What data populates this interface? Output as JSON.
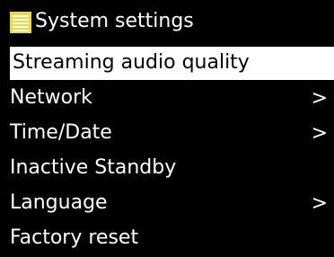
{
  "header": {
    "title": "System settings",
    "icon": "menu-list-icon",
    "icon_color": "#e8dd34"
  },
  "menu": {
    "items": [
      {
        "label": "Streaming audio quality",
        "arrow": "",
        "selected": true
      },
      {
        "label": "Network",
        "arrow": ">",
        "selected": false
      },
      {
        "label": "Time/Date",
        "arrow": ">",
        "selected": false
      },
      {
        "label": "Inactive Standby",
        "arrow": "",
        "selected": false
      },
      {
        "label": "Language",
        "arrow": ">",
        "selected": false
      },
      {
        "label": "Factory reset",
        "arrow": "",
        "selected": false
      }
    ]
  },
  "colors": {
    "background": "#000000",
    "text": "#ffffff",
    "selected_background": "#ffffff",
    "selected_text": "#000000"
  }
}
